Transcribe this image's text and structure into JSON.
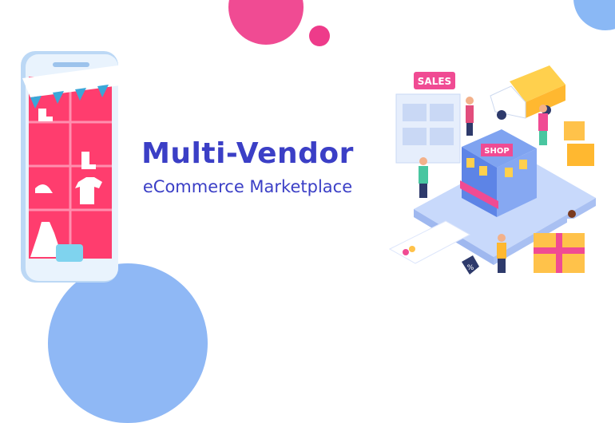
{
  "title": "Multi-Vendor",
  "subtitle": "eCommerce Marketplace",
  "illustration": {
    "sales_sign": "SALES",
    "shop_sign": "SHOP",
    "discount_tag": "%"
  },
  "colors": {
    "heading": "#3b3fc6",
    "pink_blob": "#f04b93",
    "blue_blob": "#8ab8f5",
    "phone_screen": "#ff3d6e"
  }
}
